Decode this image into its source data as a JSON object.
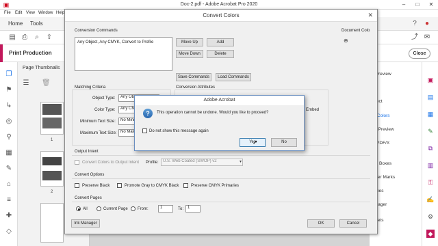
{
  "app": {
    "window_title": "Doc-2.pdf - Adobe Acrobat Pro 2020",
    "menu": [
      "File",
      "Edit",
      "View",
      "Window",
      "Help"
    ],
    "tabs": [
      "Home",
      "Tools"
    ],
    "tool_title": "Print Production",
    "close_label": "Close",
    "thumb_header": "Page Thumbnails",
    "page_numbers": [
      "1",
      "2"
    ],
    "right_panel_items": [
      "t Preview",
      "bject",
      "rt Colors",
      "er Preview",
      "s PDF/X",
      "ge Boxes",
      "inter Marks",
      "rlines",
      "anager",
      "esets"
    ]
  },
  "dialog": {
    "title": "Convert Colors",
    "conversion_commands_label": "Conversion Commands",
    "commands": [
      "Any Object, Any CMYK, Convert to Profile"
    ],
    "move_up": "Move Up",
    "add": "Add",
    "move_down": "Move Down",
    "delete": "Delete",
    "save_commands": "Save Commands",
    "load_commands": "Load Commands",
    "document_colors_label": "Document Colo",
    "matching_criteria_label": "Matching Criteria",
    "object_type_label": "Object Type:",
    "object_type_value": "Any Object",
    "color_type_label": "Color Type:",
    "color_type_value": "Any CM",
    "min_text_label": "Minimum Text Size:",
    "min_text_value": "No Minim",
    "max_text_label": "Maximum Text Size:",
    "max_text_value": "No Maxim",
    "conversion_attributes_label": "Conversion Attributes",
    "embed_label": "Embed",
    "output_intent_label": "Output Intent",
    "convert_to_output_intent": "Convert Colors to Output Intent",
    "profile_label": "Profile:",
    "profile_value": "U.S. Web Coated (SWOP) v2",
    "convert_options_label": "Convert Options",
    "preserve_black": "Preserve Black",
    "promote_gray": "Promote Gray to CMYK Black",
    "preserve_cmyk": "Preserve CMYK Primaries",
    "convert_pages_label": "Convert Pages",
    "all": "All",
    "current_page": "Current Page",
    "from": "From:",
    "from_value": "1",
    "to": "To:",
    "to_value": "1",
    "ink_manager": "Ink Manager",
    "ok": "OK",
    "cancel": "Cancel"
  },
  "alert": {
    "title": "Adobe Acrobat",
    "message": "This operation cannot be undone. Would you like to proceed?",
    "dont_show": "Do not show this message again",
    "yes": "Yes",
    "no": "No"
  }
}
